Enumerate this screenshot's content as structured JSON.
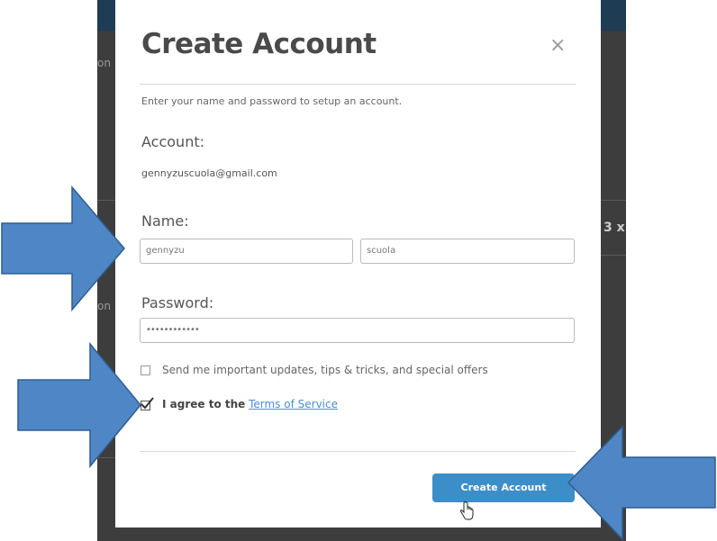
{
  "modal": {
    "title": "Create Account",
    "close_glyph": "×",
    "intro": "Enter your name and password to setup an account.",
    "account_label": "Account:",
    "account_email": "gennyzuscuola@gmail.com",
    "name_label": "Name:",
    "first_name_value": "gennyzu",
    "last_name_value": "scuola",
    "password_label": "Password:",
    "password_value": "••••••••••••",
    "updates_label": "Send me important updates, tips & tricks, and special offers",
    "updates_checked": false,
    "agree_prefix": "I agree to the",
    "terms_link": "Terms of Service",
    "agree_checked": true,
    "submit_label": "Create Account"
  },
  "backdrop_fragments": {
    "right_text": "3 x",
    "left_text_1": "on",
    "left_text_2": "on"
  },
  "colors": {
    "accent": "#3c8ec8",
    "arrow": "#4f87c6",
    "arrow_outline": "#2f5d8f"
  },
  "icons": [
    "close-icon",
    "check-icon",
    "hand-cursor-icon",
    "arrow-right-icon",
    "arrow-left-icon"
  ]
}
